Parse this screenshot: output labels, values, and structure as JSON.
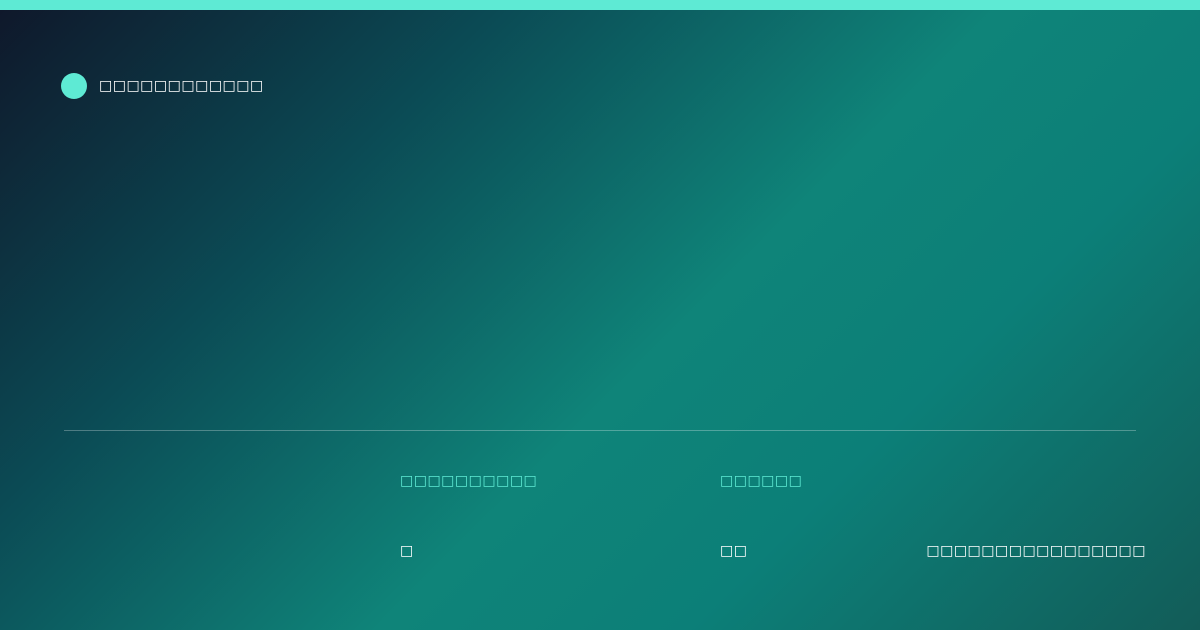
{
  "brand": {
    "name": "□□□□□□□□□□□□"
  },
  "meta": {
    "labels": [
      "□□□□□□□□□□",
      "□□□□□□"
    ],
    "values": [
      "□",
      "□□",
      "□□□□□□□□□□□□□□□□"
    ]
  },
  "colors": {
    "accent": "#5eead4",
    "text": "#ffffff"
  }
}
